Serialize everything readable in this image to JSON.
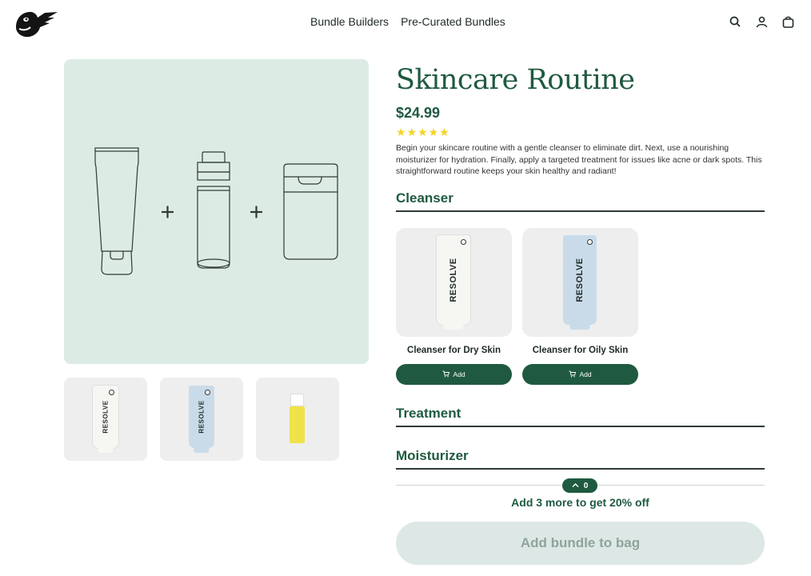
{
  "header": {
    "nav": [
      "Bundle Builders",
      "Pre-Curated Bundles"
    ],
    "icons": [
      "search-icon",
      "account-icon",
      "bag-icon"
    ]
  },
  "product": {
    "title": "Skincare Routine",
    "price": "$24.99",
    "rating": 5,
    "stars": "★★★★★",
    "description": "Begin your skincare routine with a gentle cleanser to eliminate dirt. Next, use a nourishing moisturizer for hydration. Finally, apply a targeted treatment for issues like acne or dark spots. This straightforward routine keeps your skin healthy and radiant!"
  },
  "sections": {
    "cleanser": {
      "title": "Cleanser",
      "items": [
        {
          "name": "Cleanser for Dry Skin",
          "add_label": "Add",
          "brand": "RESOLVE",
          "tube_color": "#f6f6f3"
        },
        {
          "name": "Cleanser for Oily Skin",
          "add_label": "Add",
          "brand": "RESOLVE",
          "tube_color": "#c9dbe9"
        }
      ]
    },
    "treatment": {
      "title": "Treatment"
    },
    "moisturizer": {
      "title": "Moisturizer"
    }
  },
  "progress": {
    "count": "0",
    "promo": "Add 3 more to get 20% off"
  },
  "cta": {
    "label": "Add bundle to bag"
  },
  "gallery": {
    "thumb_brand": "RESOLVE"
  },
  "colors": {
    "brand_green": "#1f5a40",
    "hero_bg": "#dcece4",
    "star": "#f5d327",
    "cta_bg": "#dde8e6"
  }
}
